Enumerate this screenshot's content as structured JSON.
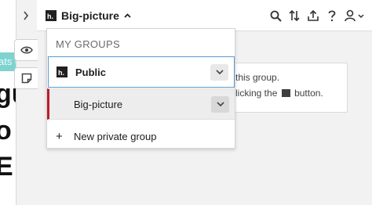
{
  "page": {
    "chip_text": "ats of",
    "line1": "gu",
    "line2": "o fo",
    "line3": "E"
  },
  "topbar": {
    "group_name": "Big-picture"
  },
  "card": {
    "line1": "this group.",
    "line2_before": "licking the",
    "line2_after": "button."
  },
  "dropdown": {
    "heading": "MY GROUPS",
    "items": [
      {
        "label": "Public"
      },
      {
        "label": "Big-picture"
      }
    ],
    "new_group_label": "New private group"
  },
  "colors": {
    "accent_blue": "#5a9ad6",
    "selected_bar": "#bd1c2b",
    "chip_teal": "#7fd3cf"
  }
}
